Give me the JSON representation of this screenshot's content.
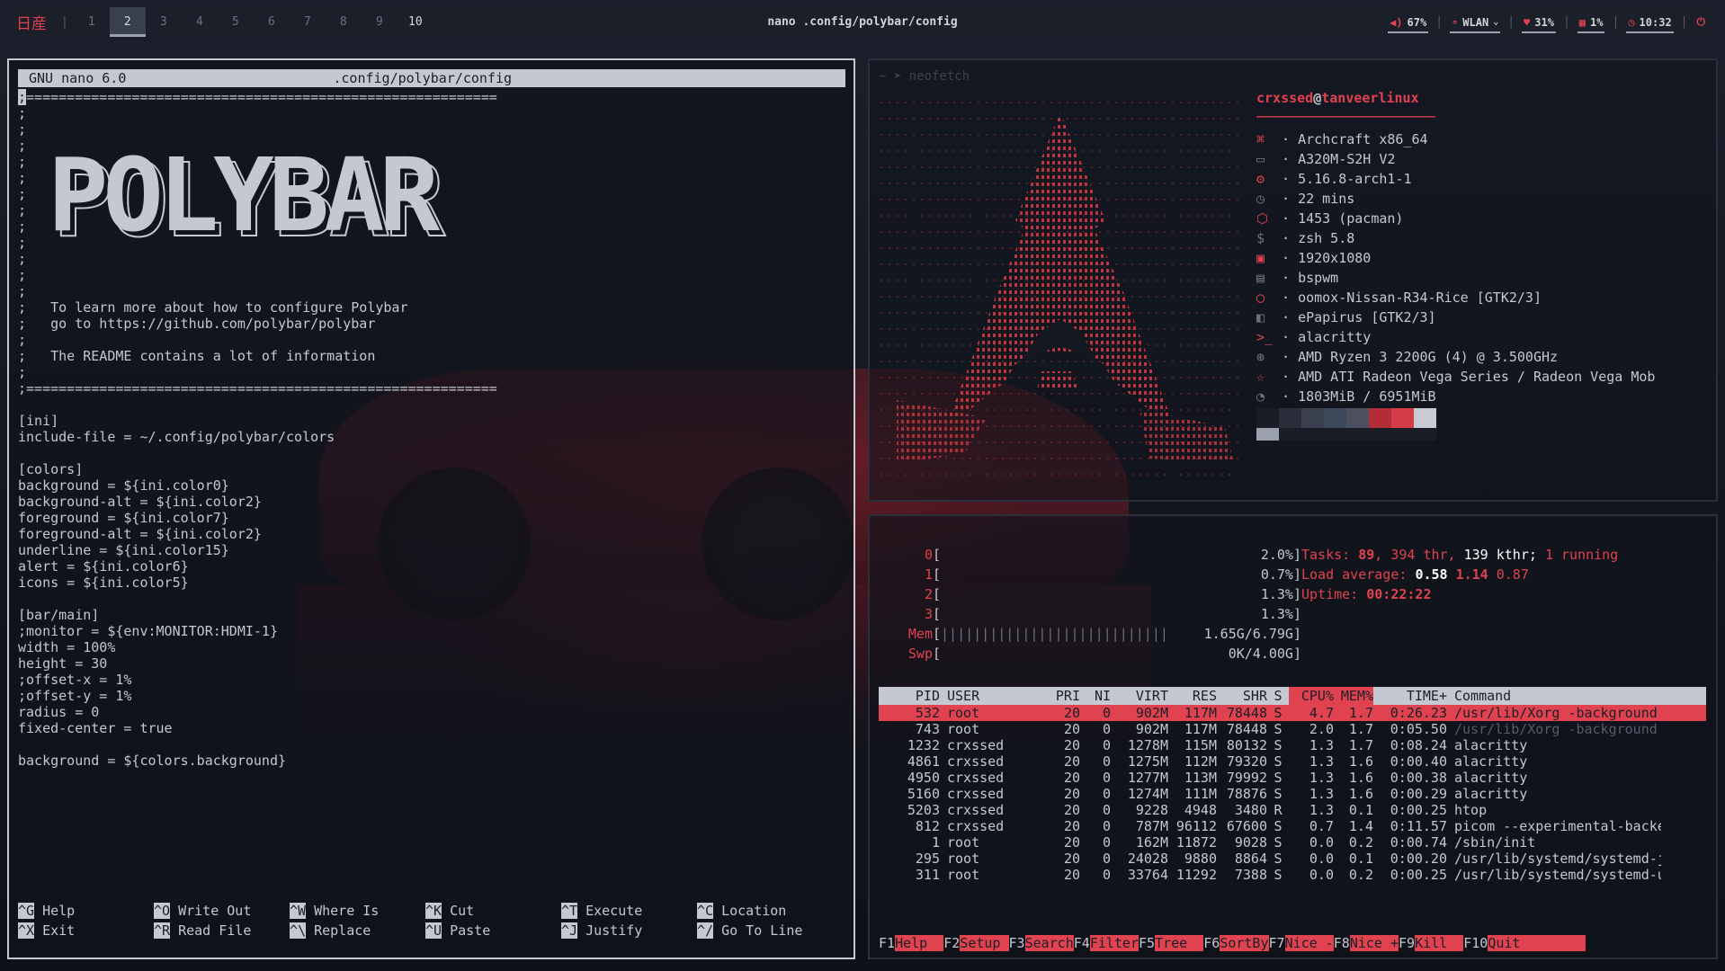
{
  "topbar": {
    "logo": "日産",
    "workspaces": [
      "1",
      "2",
      "3",
      "4",
      "5",
      "6",
      "7",
      "8",
      "9",
      "10"
    ],
    "active_workspace": "2",
    "window_title": "nano .config/polybar/config",
    "modules": {
      "volume": "67%",
      "network": "WLAN",
      "memory": "31%",
      "cpu": "1%",
      "time": "10:32"
    }
  },
  "nano": {
    "header_left": "GNU nano 6.0",
    "header_file": ".config/polybar/config",
    "lines": [
      ";==========================================================",
      ";",
      ";",
      ";",
      ";",
      ";",
      ";",
      ";",
      ";",
      ";",
      ";",
      ";",
      ";",
      ";   To learn more about how to configure Polybar",
      ";   go to https://github.com/polybar/polybar",
      ";",
      ";   The README contains a lot of information",
      ";",
      ";==========================================================",
      "",
      "[ini]",
      "include-file = ~/.config/polybar/colors",
      "",
      "[colors]",
      "background = ${ini.color0}",
      "background-alt = ${ini.color2}",
      "foreground = ${ini.color7}",
      "foreground-alt = ${ini.color2}",
      "underline = ${ini.color15}",
      "alert = ${ini.color6}",
      "icons = ${ini.color5}",
      "",
      "[bar/main]",
      ";monitor = ${env:MONITOR:HDMI-1}",
      "width = 100%",
      "height = 30",
      ";offset-x = 1%",
      ";offset-y = 1%",
      "radius = 0",
      "fixed-center = true",
      "",
      "background = ${colors.background}"
    ],
    "art_text": "POLYBAR",
    "shortcuts": [
      [
        {
          "key": "^G",
          "label": "Help"
        },
        {
          "key": "^O",
          "label": "Write Out"
        },
        {
          "key": "^W",
          "label": "Where Is"
        },
        {
          "key": "^K",
          "label": "Cut"
        },
        {
          "key": "^T",
          "label": "Execute"
        },
        {
          "key": "^C",
          "label": "Location"
        }
      ],
      [
        {
          "key": "^X",
          "label": "Exit"
        },
        {
          "key": "^R",
          "label": "Read File"
        },
        {
          "key": "^\\",
          "label": "Replace"
        },
        {
          "key": "^U",
          "label": "Paste"
        },
        {
          "key": "^J",
          "label": "Justify"
        },
        {
          "key": "^/",
          "label": "Go To Line"
        }
      ]
    ]
  },
  "neofetch": {
    "prompt": "~ ➤ neofetch",
    "user": "crxssed",
    "at": "@",
    "host": "tanveerlinux",
    "rule": "──────────────────────",
    "info": [
      {
        "icon": "⌘",
        "value": "Archcraft x86_64"
      },
      {
        "icon": "▭",
        "value": "A320M-S2H V2"
      },
      {
        "icon": "⚙",
        "value": "5.16.8-arch1-1"
      },
      {
        "icon": "◷",
        "value": "22 mins"
      },
      {
        "icon": "⬡",
        "value": "1453 (pacman)"
      },
      {
        "icon": "$",
        "value": "zsh 5.8"
      },
      {
        "icon": "▣",
        "value": "1920x1080"
      },
      {
        "icon": "▤",
        "value": "bspwm"
      },
      {
        "icon": "◯",
        "value": "oomox-Nissan-R34-Rice [GTK2/3]"
      },
      {
        "icon": "◧",
        "value": "ePapirus [GTK2/3]"
      },
      {
        "icon": ">_",
        "value": "alacritty"
      },
      {
        "icon": "⊛",
        "value": "AMD Ryzen 3 2200G (4) @ 3.500GHz"
      },
      {
        "icon": "☆",
        "value": "AMD ATI Radeon Vega Series / Radeon Vega Mob"
      },
      {
        "icon": "◔",
        "value": "1803MiB / 6951MiB"
      }
    ],
    "palette": [
      "#1a1d25",
      "#2a2e3a",
      "#3a3f4d",
      "#3d4a5c",
      "#4b4f5e",
      "#b32d38",
      "#d63c48",
      "#c9cad3"
    ],
    "palette_bottom": [
      "#9aa0ae",
      "#1a1d25",
      "#1a1d25",
      "#1a1d25",
      "#1a1d25",
      "#1a1d25",
      "#1a1d25",
      "#1a1d25"
    ]
  },
  "htop": {
    "meters": [
      {
        "label": "0",
        "value": "2.0%"
      },
      {
        "label": "1",
        "value": "0.7%"
      },
      {
        "label": "2",
        "value": "1.3%"
      },
      {
        "label": "3",
        "value": "1.3%"
      },
      {
        "label": "Mem",
        "value": "1.65G/6.79G",
        "bar": "||||||||||||||||||||||||||||"
      },
      {
        "label": "Swp",
        "value": "0K/4.00G"
      }
    ],
    "tasks_label": "Tasks:",
    "tasks": "89",
    "threads": "394 thr,",
    "kthreads": "139 kthr;",
    "running": "1 running",
    "load_label": "Load average:",
    "load1": "0.58",
    "load5": "1.14",
    "load15": "0.87",
    "uptime_label": "Uptime:",
    "uptime": "00:22:22",
    "columns": [
      "PID",
      "USER",
      "PRI",
      "NI",
      "VIRT",
      "RES",
      "SHR",
      "S",
      "CPU%",
      "MEM%",
      "TIME+",
      "Command"
    ],
    "processes": [
      [
        "532",
        "root",
        "20",
        "0",
        "902M",
        "117M",
        "78448",
        "S",
        "4.7",
        "1.7",
        "0:26.23",
        "/usr/lib/Xorg -background"
      ],
      [
        "743",
        "root",
        "20",
        "0",
        "902M",
        "117M",
        "78448",
        "S",
        "2.0",
        "1.7",
        "0:05.50",
        "/usr/lib/Xorg -background"
      ],
      [
        "1232",
        "crxssed",
        "20",
        "0",
        "1278M",
        "115M",
        "80132",
        "S",
        "1.3",
        "1.7",
        "0:08.24",
        "alacritty"
      ],
      [
        "4861",
        "crxssed",
        "20",
        "0",
        "1275M",
        "112M",
        "79320",
        "S",
        "1.3",
        "1.6",
        "0:00.40",
        "alacritty"
      ],
      [
        "4950",
        "crxssed",
        "20",
        "0",
        "1277M",
        "113M",
        "79992",
        "S",
        "1.3",
        "1.6",
        "0:00.38",
        "alacritty"
      ],
      [
        "5160",
        "crxssed",
        "20",
        "0",
        "1274M",
        "111M",
        "78876",
        "S",
        "1.3",
        "1.6",
        "0:00.29",
        "alacritty"
      ],
      [
        "5203",
        "crxssed",
        "20",
        "0",
        "9228",
        "4948",
        "3480",
        "R",
        "1.3",
        "0.1",
        "0:00.25",
        "htop"
      ],
      [
        "812",
        "crxssed",
        "20",
        "0",
        "787M",
        "96112",
        "67600",
        "S",
        "0.7",
        "1.4",
        "0:11.57",
        "picom --experimental-backe"
      ],
      [
        "1",
        "root",
        "20",
        "0",
        "162M",
        "11872",
        "9028",
        "S",
        "0.0",
        "0.2",
        "0:00.74",
        "/sbin/init"
      ],
      [
        "295",
        "root",
        "20",
        "0",
        "24028",
        "9880",
        "8864",
        "S",
        "0.0",
        "0.1",
        "0:00.20",
        "/usr/lib/systemd/systemd-j"
      ],
      [
        "311",
        "root",
        "20",
        "0",
        "33764",
        "11292",
        "7388",
        "S",
        "0.0",
        "0.2",
        "0:00.25",
        "/usr/lib/systemd/systemd-u"
      ]
    ],
    "fkeys": [
      {
        "n": "F1",
        "l": "Help  "
      },
      {
        "n": "F2",
        "l": "Setup "
      },
      {
        "n": "F3",
        "l": "Search"
      },
      {
        "n": "F4",
        "l": "Filter"
      },
      {
        "n": "F5",
        "l": "Tree  "
      },
      {
        "n": "F6",
        "l": "SortBy"
      },
      {
        "n": "F7",
        "l": "Nice -"
      },
      {
        "n": "F8",
        "l": "Nice +"
      },
      {
        "n": "F9",
        "l": "Kill  "
      },
      {
        "n": "F10",
        "l": "Quit        "
      }
    ]
  },
  "colors": {
    "accent": "#e0434f",
    "fg": "#c5c8d0",
    "bg": "#1b1f29"
  }
}
